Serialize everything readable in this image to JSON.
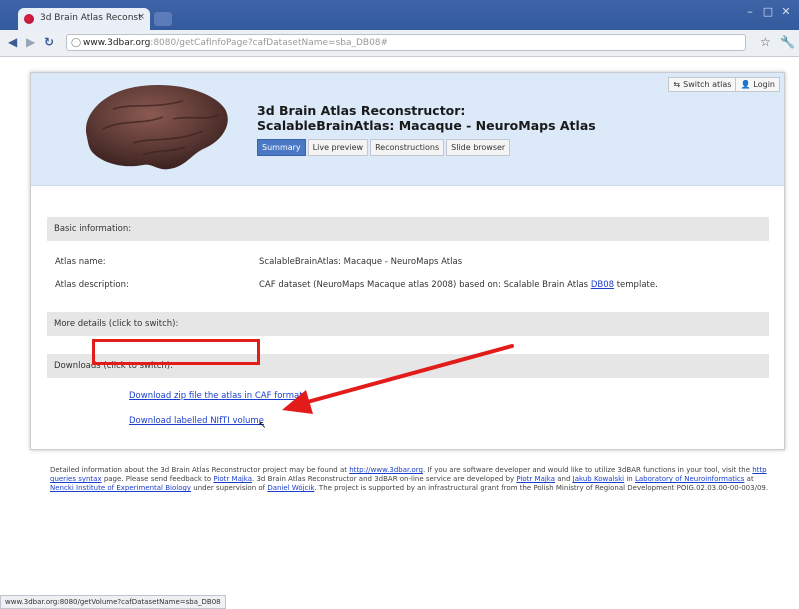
{
  "browser": {
    "tab_title": "3d Brain Atlas Reconst",
    "tab_close": "×",
    "url_host": "www.3dbar.org",
    "url_rest": ":8080/getCafInfoPage?cafDatasetName=sba_DB08#",
    "status_url": "www.3dbar.org:8080/getVolume?cafDatasetName=sba_DB08"
  },
  "header": {
    "switch_atlas": "Switch atlas",
    "login": "Login",
    "title_line1": "3d Brain Atlas Reconstructor:",
    "title_line2": "ScalableBrainAtlas: Macaque - NeuroMaps Atlas",
    "tabs": [
      {
        "label": "Summary",
        "active": true
      },
      {
        "label": "Live preview",
        "active": false
      },
      {
        "label": "Reconstructions",
        "active": false
      },
      {
        "label": "Slide browser",
        "active": false
      }
    ]
  },
  "basic": {
    "section_title": "Basic information:",
    "atlas_name_label": "Atlas name:",
    "atlas_name_value": "ScalableBrainAtlas: Macaque - NeuroMaps Atlas",
    "atlas_desc_label": "Atlas description:",
    "atlas_desc_before": "CAF dataset (NeuroMaps Macaque atlas 2008) based on: Scalable Brain Atlas ",
    "atlas_desc_link": "DB08",
    "atlas_desc_after": " template."
  },
  "more_details": {
    "section_title": "More details (click to switch):"
  },
  "downloads": {
    "section_title": "Downloads (click to switch):",
    "link_caf": "Download zip file the atlas in CAF format",
    "link_nifti": "Download labelled NIfTI volume"
  },
  "footer": {
    "p1": "Detailed information about the 3d Brain Atlas Reconstructor project may be found at ",
    "l1": "http://www.3dbar.org",
    "p2": ". If you are software developer and would like to utilize 3dBAR functions in your tool, visit the ",
    "l2": "http queries syntax",
    "p3": " page. Please send feedback to ",
    "l3": "Piotr Majka",
    "p4": ". 3d Brain Atlas Reconstructor and 3dBAR on-line service are developed by ",
    "l4": "Piotr Majka",
    "p5": " and ",
    "l5": "Jakub Kowalski",
    "p6": " in ",
    "l6": "Laboratory of Neuroinformatics",
    "p7": " at ",
    "l7": "Nencki Institute of Experimental Biology",
    "p8": " under supervision of ",
    "l8": "Daniel Wójcik",
    "p9": ". The project is supported by an infrastructural grant from the Polish Ministry of Regional Development POIG.02.03.00-00-003/09."
  },
  "colors": {
    "header_bg": "#dbe9f9",
    "active_tab": "#4a78c4",
    "highlight": "#e21b1b",
    "link": "#1a3fcc"
  }
}
